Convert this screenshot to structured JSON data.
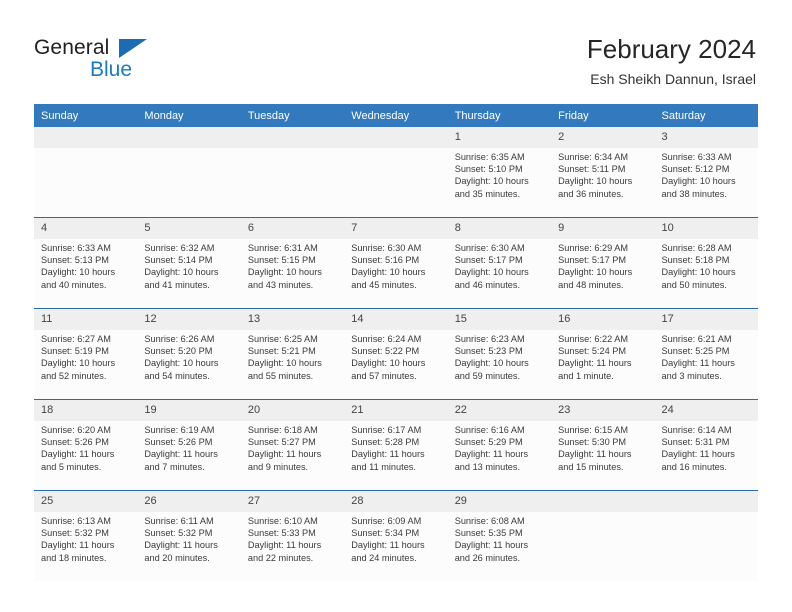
{
  "brand": {
    "name_part1": "General",
    "name_part2": "Blue"
  },
  "header": {
    "title": "February 2024",
    "subtitle": "Esh Sheikh Dannun, Israel"
  },
  "colors": {
    "header_blue": "#3279bd",
    "row_divider_blue": "#2b6ca8",
    "daynum_band": "#efefef",
    "logo_blue": "#1b7ac4"
  },
  "weekday_headers": [
    "Sunday",
    "Monday",
    "Tuesday",
    "Wednesday",
    "Thursday",
    "Friday",
    "Saturday"
  ],
  "weeks": [
    [
      {
        "day": "",
        "sunrise": "",
        "sunset": "",
        "daylight": "",
        "empty": true
      },
      {
        "day": "",
        "sunrise": "",
        "sunset": "",
        "daylight": "",
        "empty": true
      },
      {
        "day": "",
        "sunrise": "",
        "sunset": "",
        "daylight": "",
        "empty": true
      },
      {
        "day": "",
        "sunrise": "",
        "sunset": "",
        "daylight": "",
        "empty": true
      },
      {
        "day": "1",
        "sunrise": "Sunrise: 6:35 AM",
        "sunset": "Sunset: 5:10 PM",
        "daylight": "Daylight: 10 hours and 35 minutes."
      },
      {
        "day": "2",
        "sunrise": "Sunrise: 6:34 AM",
        "sunset": "Sunset: 5:11 PM",
        "daylight": "Daylight: 10 hours and 36 minutes."
      },
      {
        "day": "3",
        "sunrise": "Sunrise: 6:33 AM",
        "sunset": "Sunset: 5:12 PM",
        "daylight": "Daylight: 10 hours and 38 minutes."
      }
    ],
    [
      {
        "day": "4",
        "sunrise": "Sunrise: 6:33 AM",
        "sunset": "Sunset: 5:13 PM",
        "daylight": "Daylight: 10 hours and 40 minutes."
      },
      {
        "day": "5",
        "sunrise": "Sunrise: 6:32 AM",
        "sunset": "Sunset: 5:14 PM",
        "daylight": "Daylight: 10 hours and 41 minutes."
      },
      {
        "day": "6",
        "sunrise": "Sunrise: 6:31 AM",
        "sunset": "Sunset: 5:15 PM",
        "daylight": "Daylight: 10 hours and 43 minutes."
      },
      {
        "day": "7",
        "sunrise": "Sunrise: 6:30 AM",
        "sunset": "Sunset: 5:16 PM",
        "daylight": "Daylight: 10 hours and 45 minutes."
      },
      {
        "day": "8",
        "sunrise": "Sunrise: 6:30 AM",
        "sunset": "Sunset: 5:17 PM",
        "daylight": "Daylight: 10 hours and 46 minutes."
      },
      {
        "day": "9",
        "sunrise": "Sunrise: 6:29 AM",
        "sunset": "Sunset: 5:17 PM",
        "daylight": "Daylight: 10 hours and 48 minutes."
      },
      {
        "day": "10",
        "sunrise": "Sunrise: 6:28 AM",
        "sunset": "Sunset: 5:18 PM",
        "daylight": "Daylight: 10 hours and 50 minutes."
      }
    ],
    [
      {
        "day": "11",
        "sunrise": "Sunrise: 6:27 AM",
        "sunset": "Sunset: 5:19 PM",
        "daylight": "Daylight: 10 hours and 52 minutes."
      },
      {
        "day": "12",
        "sunrise": "Sunrise: 6:26 AM",
        "sunset": "Sunset: 5:20 PM",
        "daylight": "Daylight: 10 hours and 54 minutes."
      },
      {
        "day": "13",
        "sunrise": "Sunrise: 6:25 AM",
        "sunset": "Sunset: 5:21 PM",
        "daylight": "Daylight: 10 hours and 55 minutes."
      },
      {
        "day": "14",
        "sunrise": "Sunrise: 6:24 AM",
        "sunset": "Sunset: 5:22 PM",
        "daylight": "Daylight: 10 hours and 57 minutes."
      },
      {
        "day": "15",
        "sunrise": "Sunrise: 6:23 AM",
        "sunset": "Sunset: 5:23 PM",
        "daylight": "Daylight: 10 hours and 59 minutes."
      },
      {
        "day": "16",
        "sunrise": "Sunrise: 6:22 AM",
        "sunset": "Sunset: 5:24 PM",
        "daylight": "Daylight: 11 hours and 1 minute."
      },
      {
        "day": "17",
        "sunrise": "Sunrise: 6:21 AM",
        "sunset": "Sunset: 5:25 PM",
        "daylight": "Daylight: 11 hours and 3 minutes."
      }
    ],
    [
      {
        "day": "18",
        "sunrise": "Sunrise: 6:20 AM",
        "sunset": "Sunset: 5:26 PM",
        "daylight": "Daylight: 11 hours and 5 minutes."
      },
      {
        "day": "19",
        "sunrise": "Sunrise: 6:19 AM",
        "sunset": "Sunset: 5:26 PM",
        "daylight": "Daylight: 11 hours and 7 minutes."
      },
      {
        "day": "20",
        "sunrise": "Sunrise: 6:18 AM",
        "sunset": "Sunset: 5:27 PM",
        "daylight": "Daylight: 11 hours and 9 minutes."
      },
      {
        "day": "21",
        "sunrise": "Sunrise: 6:17 AM",
        "sunset": "Sunset: 5:28 PM",
        "daylight": "Daylight: 11 hours and 11 minutes."
      },
      {
        "day": "22",
        "sunrise": "Sunrise: 6:16 AM",
        "sunset": "Sunset: 5:29 PM",
        "daylight": "Daylight: 11 hours and 13 minutes."
      },
      {
        "day": "23",
        "sunrise": "Sunrise: 6:15 AM",
        "sunset": "Sunset: 5:30 PM",
        "daylight": "Daylight: 11 hours and 15 minutes."
      },
      {
        "day": "24",
        "sunrise": "Sunrise: 6:14 AM",
        "sunset": "Sunset: 5:31 PM",
        "daylight": "Daylight: 11 hours and 16 minutes."
      }
    ],
    [
      {
        "day": "25",
        "sunrise": "Sunrise: 6:13 AM",
        "sunset": "Sunset: 5:32 PM",
        "daylight": "Daylight: 11 hours and 18 minutes."
      },
      {
        "day": "26",
        "sunrise": "Sunrise: 6:11 AM",
        "sunset": "Sunset: 5:32 PM",
        "daylight": "Daylight: 11 hours and 20 minutes."
      },
      {
        "day": "27",
        "sunrise": "Sunrise: 6:10 AM",
        "sunset": "Sunset: 5:33 PM",
        "daylight": "Daylight: 11 hours and 22 minutes."
      },
      {
        "day": "28",
        "sunrise": "Sunrise: 6:09 AM",
        "sunset": "Sunset: 5:34 PM",
        "daylight": "Daylight: 11 hours and 24 minutes."
      },
      {
        "day": "29",
        "sunrise": "Sunrise: 6:08 AM",
        "sunset": "Sunset: 5:35 PM",
        "daylight": "Daylight: 11 hours and 26 minutes."
      },
      {
        "day": "",
        "sunrise": "",
        "sunset": "",
        "daylight": "",
        "empty": true
      },
      {
        "day": "",
        "sunrise": "",
        "sunset": "",
        "daylight": "",
        "empty": true
      }
    ]
  ]
}
